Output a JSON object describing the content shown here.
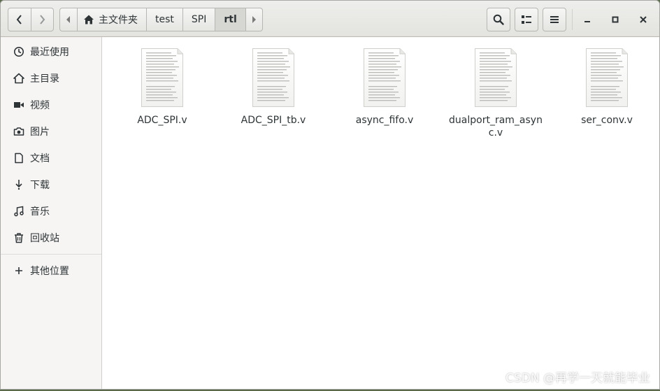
{
  "pathbar": {
    "home_label": "主文件夹",
    "crumbs": [
      "test",
      "SPI",
      "rtl"
    ]
  },
  "sidebar": {
    "items": [
      {
        "label": "最近使用",
        "icon": "clock-icon"
      },
      {
        "label": "主目录",
        "icon": "home-icon"
      },
      {
        "label": "视频",
        "icon": "video-icon"
      },
      {
        "label": "图片",
        "icon": "camera-icon"
      },
      {
        "label": "文档",
        "icon": "document-icon"
      },
      {
        "label": "下载",
        "icon": "download-icon"
      },
      {
        "label": "音乐",
        "icon": "music-icon"
      },
      {
        "label": "回收站",
        "icon": "trash-icon"
      }
    ],
    "other_locations": "其他位置"
  },
  "files": [
    {
      "name": "ADC_SPI.v"
    },
    {
      "name": "ADC_SPI_tb.v"
    },
    {
      "name": "async_fifo.v"
    },
    {
      "name": "dualport_ram_async.v"
    },
    {
      "name": "ser_conv.v"
    }
  ],
  "watermark": "CSDN @再学一天就能毕业"
}
